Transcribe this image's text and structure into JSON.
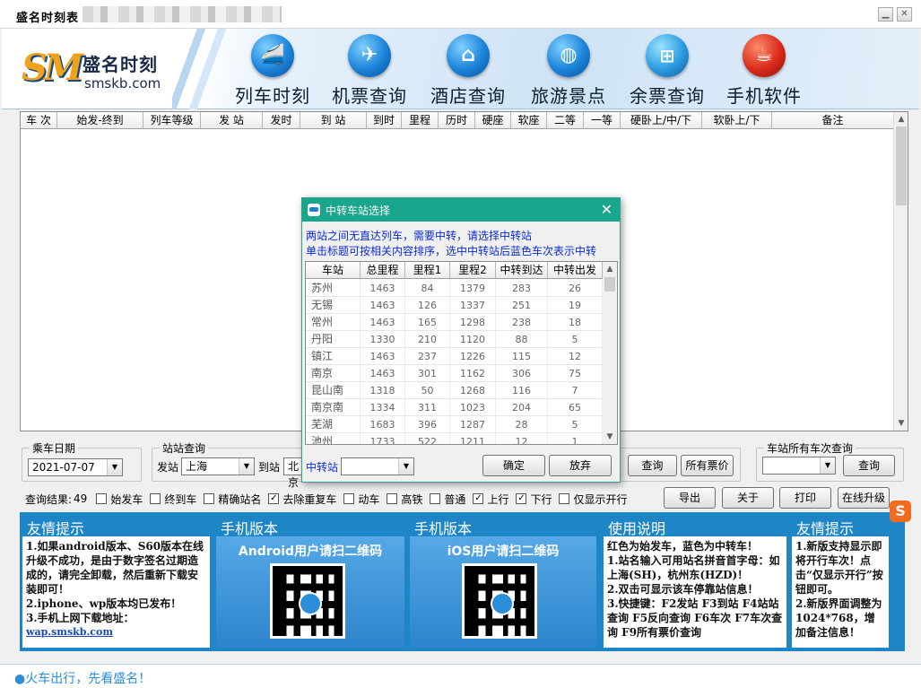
{
  "window": {
    "title": "盛名时刻表",
    "minimize": "▁",
    "close": "✕"
  },
  "logo": {
    "mark": "SM",
    "name": "盛名时刻",
    "url": "smskb.com"
  },
  "nav": [
    {
      "label": "列车时刻",
      "icon": "train-icon",
      "glyph": "🚄"
    },
    {
      "label": "机票查询",
      "icon": "plane-icon",
      "glyph": "✈"
    },
    {
      "label": "酒店查询",
      "icon": "hotel-icon",
      "glyph": "⌂"
    },
    {
      "label": "旅游景点",
      "icon": "globe-icon",
      "glyph": "◍"
    },
    {
      "label": "余票查询",
      "icon": "windows-icon",
      "glyph": "⊞"
    },
    {
      "label": "手机软件",
      "icon": "java-icon",
      "glyph": "☕"
    }
  ],
  "grid": {
    "columns": [
      "车 次",
      "始发-终到",
      "列车等级",
      "发 站",
      "发时",
      "到 站",
      "到时",
      "里程",
      "历时",
      "硬座",
      "软座",
      "二等",
      "一等",
      "硬卧上/中/下",
      "软卧上/下",
      "备注"
    ]
  },
  "date_group": {
    "label": "乘车日期",
    "value": "2021-07-07"
  },
  "station_group": {
    "label": "站站查询",
    "from_label": "发站",
    "from_value": "上海",
    "to_label": "到站",
    "to_value": "北京"
  },
  "query_buttons": {
    "query": "查询",
    "all_fares": "所有票价"
  },
  "station_trains": {
    "label": "车站所有车次查询",
    "value": "",
    "query": "查询"
  },
  "results": {
    "label": "查询结果:",
    "count": "49"
  },
  "filters": [
    {
      "label": "始发车",
      "checked": false
    },
    {
      "label": "终到车",
      "checked": false
    },
    {
      "label": "精确站名",
      "checked": false
    },
    {
      "label": "去除重复车",
      "checked": true
    },
    {
      "label": "动车",
      "checked": false
    },
    {
      "label": "高铁",
      "checked": false
    },
    {
      "label": "普通",
      "checked": false
    },
    {
      "label": "上行",
      "checked": true
    },
    {
      "label": "下行",
      "checked": true
    },
    {
      "label": "仅显示开行",
      "checked": false
    }
  ],
  "action_buttons": {
    "export": "导出",
    "about": "关于",
    "print": "打印",
    "upgrade": "在线升级"
  },
  "panels": {
    "tips1": {
      "title": "友情提示",
      "lines": [
        "1.如果android版本、S60版本在线升级不成功，是由于数字签名过期造成的，请完全卸载，然后重新下载安装即可！",
        "2.iphone、wp版本均已发布！",
        "3.手机上网下载地址："
      ],
      "link": "wap.smskb.com"
    },
    "android": {
      "title": "手机版本",
      "caption": "Android用户请扫二维码"
    },
    "ios": {
      "title": "手机版本",
      "caption": "iOS用户请扫二维码"
    },
    "usage": {
      "title": "使用说明",
      "lines": [
        "红色为始发车，蓝色为中转车！",
        "1.站名输入可用站名拼音首字母：如上海(SH)，杭州东(HZD)！",
        "2.双击可显示该车停靠站信息！",
        "3.快捷键：F2发站 F3到站 F4站站查询 F5反向查询 F6车次 F7车次查询 F9所有票价查询"
      ]
    },
    "tips2": {
      "title": "友情提示",
      "lines": [
        "1.新版支持显示即将开行车次！点击“仅显示开行”按钮即可。",
        "2.新版界面调整为1024*768，增加备注信息！"
      ]
    }
  },
  "footer": {
    "message": "●火车出行，先看盛名！"
  },
  "ime": {
    "glyph": "S"
  },
  "dialog": {
    "title": "中转车站选择",
    "hint1": "两站之间无直达列车，需要中转，请选择中转站",
    "hint2": "单击标题可按相关内容排序，选中中转站后蓝色车次表示中转",
    "columns": [
      "车站",
      "总里程",
      "里程1",
      "里程2",
      "中转到达",
      "中转出发"
    ],
    "rows": [
      [
        "苏州",
        "1463",
        "84",
        "1379",
        "283",
        "26"
      ],
      [
        "无锡",
        "1463",
        "126",
        "1337",
        "251",
        "19"
      ],
      [
        "常州",
        "1463",
        "165",
        "1298",
        "238",
        "18"
      ],
      [
        "丹阳",
        "1330",
        "210",
        "1120",
        "88",
        "5"
      ],
      [
        "镇江",
        "1463",
        "237",
        "1226",
        "115",
        "12"
      ],
      [
        "南京",
        "1463",
        "301",
        "1162",
        "306",
        "75"
      ],
      [
        "昆山南",
        "1318",
        "50",
        "1268",
        "116",
        "7"
      ],
      [
        "南京南",
        "1334",
        "311",
        "1023",
        "204",
        "65"
      ],
      [
        "芜湖",
        "1683",
        "396",
        "1287",
        "28",
        "5"
      ],
      [
        "池州",
        "1733",
        "522",
        "1211",
        "12",
        "1"
      ]
    ],
    "transfer_label": "中转站",
    "transfer_value": "",
    "ok": "确定",
    "cancel": "放弃"
  }
}
